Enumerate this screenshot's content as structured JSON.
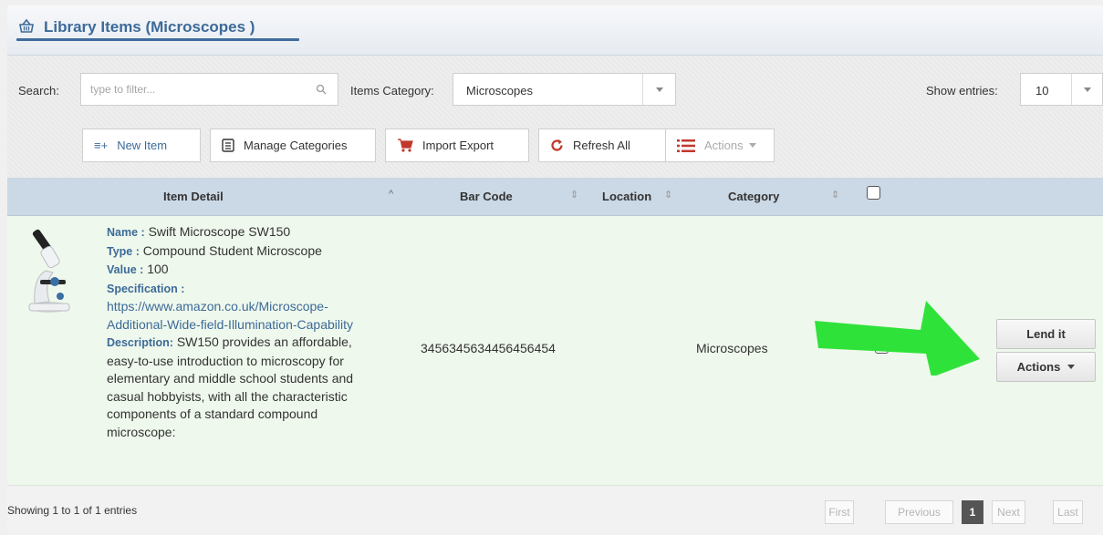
{
  "header": {
    "title": "Library Items (Microscopes )",
    "icon": "basket-icon"
  },
  "toolbar": {
    "search_label": "Search:",
    "search_placeholder": "type to filter...",
    "category_label": "Items Category:",
    "category_value": "Microscopes",
    "entries_label": "Show entries:",
    "entries_value": "10",
    "buttons": {
      "new_item": "New Item",
      "manage_categories": "Manage Categories",
      "import_export": "Import Export",
      "refresh_all": "Refresh All",
      "actions": "Actions"
    }
  },
  "table": {
    "columns": {
      "item_detail": "Item Detail",
      "bar_code": "Bar Code",
      "location": "Location",
      "category": "Category"
    },
    "rows": [
      {
        "name_key": "Name :",
        "name": "Swift Microscope SW150",
        "type_key": "Type :",
        "type": "Compound Student Microscope",
        "value_key": "Value :",
        "value": "100",
        "spec_key": "Specification :",
        "spec_line1": "https://www.amazon.co.uk/Microscope-",
        "spec_line2": "Additional-Wide-field-Illumination-Capability",
        "desc_key": "Description:",
        "desc_l1": "SW150 provides an affordable,",
        "desc_l2": "easy-to-use introduction to microscopy for",
        "desc_l3": "elementary and middle school students and",
        "desc_l4": "casual hobbyists, with all the characteristic",
        "desc_l5": "components of a standard compound",
        "desc_l6": "microscope:",
        "bar_code": "3456345634456456454",
        "location": "",
        "category": "Microscopes",
        "lend_label": "Lend it",
        "actions_label": "Actions"
      }
    ]
  },
  "footer": {
    "showing": "Showing 1 to 1 of 1 entries",
    "pagination": {
      "first": "First",
      "previous": "Previous",
      "current": "1",
      "next": "Next",
      "last": "Last"
    }
  },
  "colors": {
    "accent": "#3d6a99",
    "header_bg": "#cbd8e5",
    "row_bg": "#eef8ec",
    "arrow": "#2fe23a"
  }
}
